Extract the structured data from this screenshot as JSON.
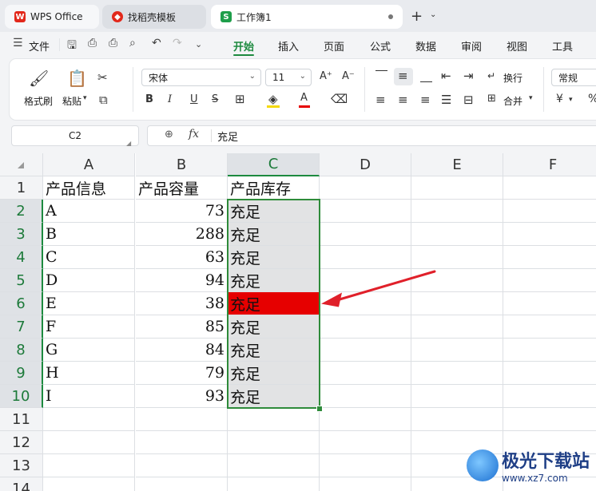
{
  "tabs": [
    {
      "label": "WPS Office",
      "icon": "wps-logo-icon"
    },
    {
      "label": "找稻壳模板",
      "icon": "daoke-logo-icon"
    },
    {
      "label": "工作簿1",
      "icon": "spreadsheet-icon",
      "active": true
    }
  ],
  "tabbar": {
    "add_tab": "+",
    "add_dropdown": "⌄"
  },
  "menu": {
    "file": "文件",
    "tabs": [
      "开始",
      "插入",
      "页面",
      "公式",
      "数据",
      "审阅",
      "视图",
      "工具"
    ],
    "active_tab": "开始"
  },
  "ribbon": {
    "format_painter": "格式刷",
    "paste": "粘贴",
    "font_name": "宋体",
    "font_size": "11",
    "bold": "B",
    "italic": "I",
    "underline": "U",
    "strike": "S",
    "wrap": "换行",
    "merge": "合并",
    "number_format": "常规",
    "currency": "¥",
    "percent": "%"
  },
  "formula_bar": {
    "cell_ref": "C2",
    "fx": "fx",
    "content": "充足"
  },
  "columns": [
    "A",
    "B",
    "C",
    "D",
    "E",
    "F"
  ],
  "rows": [
    "1",
    "2",
    "3",
    "4",
    "5",
    "6",
    "7",
    "8",
    "9",
    "10",
    "11",
    "12",
    "13",
    "14"
  ],
  "headers": [
    "产品信息",
    "产品容量",
    "产品库存"
  ],
  "data": [
    {
      "name": "A",
      "capacity": "73",
      "stock": "充足"
    },
    {
      "name": "B",
      "capacity": "288",
      "stock": "充足"
    },
    {
      "name": "C",
      "capacity": "63",
      "stock": "充足"
    },
    {
      "name": "D",
      "capacity": "94",
      "stock": "充足"
    },
    {
      "name": "E",
      "capacity": "38",
      "stock": "充足"
    },
    {
      "name": "F",
      "capacity": "85",
      "stock": "充足"
    },
    {
      "name": "G",
      "capacity": "84",
      "stock": "充足"
    },
    {
      "name": "H",
      "capacity": "79",
      "stock": "充足"
    },
    {
      "name": "I",
      "capacity": "93",
      "stock": "充足"
    }
  ],
  "highlight": {
    "row": "6",
    "color": "#e60000"
  },
  "selection": {
    "range": "C2:C10",
    "color": "#2e8b3a"
  },
  "arrow_color": "#e0202a",
  "watermark": {
    "title": "极光下载站",
    "url": "www.xz7.com"
  }
}
